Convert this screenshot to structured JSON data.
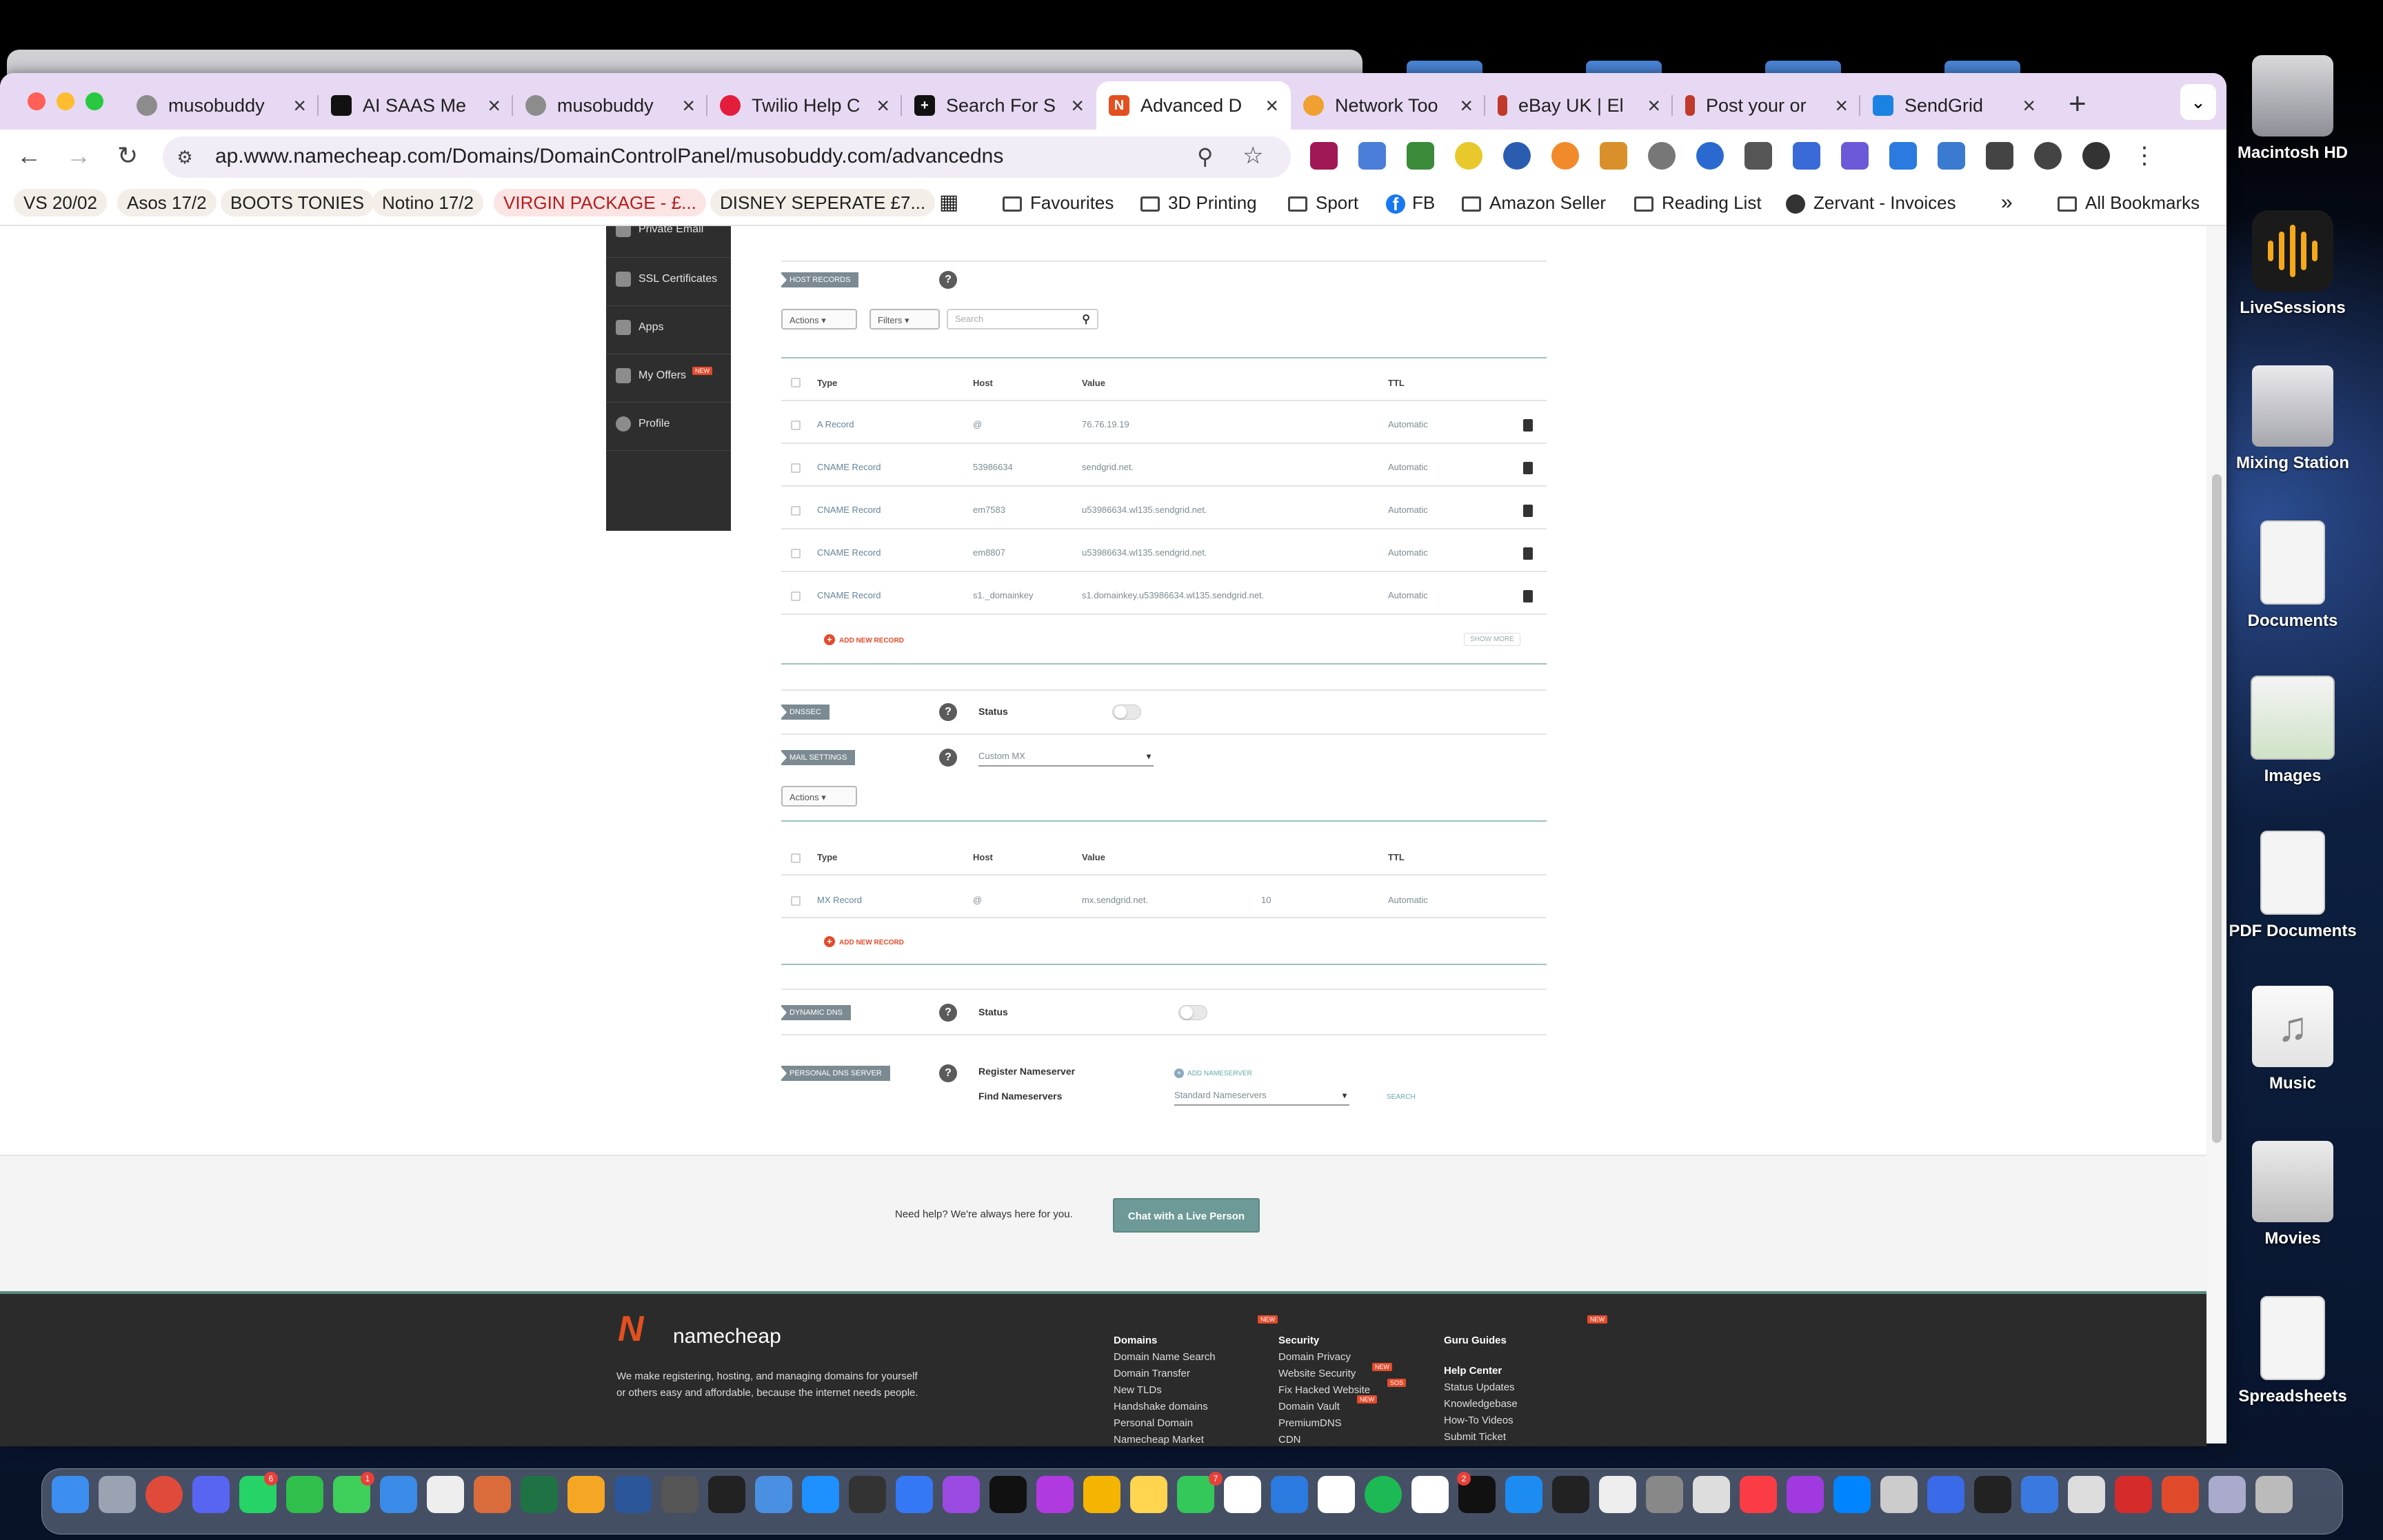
{
  "desktop": {
    "icons": [
      {
        "label": "Macintosh HD",
        "icon": "hard-drive-icon"
      },
      {
        "label": "LiveSessions",
        "icon": "waveform-app-icon"
      },
      {
        "label": "Mixing Station",
        "icon": "external-drive-icon"
      },
      {
        "label": "Documents",
        "icon": "document-stack-icon"
      },
      {
        "label": "Images",
        "icon": "image-stack-icon"
      },
      {
        "label": "PDF Documents",
        "icon": "pdf-stack-icon"
      },
      {
        "label": "Music",
        "icon": "music-file-icon"
      },
      {
        "label": "Movies",
        "icon": "movie-stack-icon"
      },
      {
        "label": "Spreadsheets",
        "icon": "spreadsheet-stack-icon"
      }
    ]
  },
  "browser": {
    "tabs": [
      {
        "title": "musobuddy",
        "icon": "globe-icon",
        "color": "#777777"
      },
      {
        "title": "AI SAAS Me",
        "icon": "aw-logo-icon",
        "color": "#111111"
      },
      {
        "title": "musobuddy",
        "icon": "globe-icon",
        "color": "#777777"
      },
      {
        "title": "Twilio Help C",
        "icon": "twilio-icon",
        "color": "#e31e3c"
      },
      {
        "title": "Search For S",
        "icon": "plus-icon",
        "color": "#111111"
      },
      {
        "title": "Advanced D",
        "icon": "namecheap-icon",
        "color": "#e35020",
        "active": true
      },
      {
        "title": "Network Too",
        "icon": "network-tool-icon",
        "color": "#f0a030"
      },
      {
        "title": "eBay UK | El",
        "icon": "ebay-icon",
        "color": "#c0392b"
      },
      {
        "title": "Post your or",
        "icon": "post-icon",
        "color": "#c0392b"
      },
      {
        "title": "SendGrid",
        "icon": "sendgrid-icon",
        "color": "#1a82e2"
      }
    ],
    "new_tab": "+",
    "tab_close": "×",
    "url": "ap.www.namecheap.com/Domains/DomainControlPanel/musobuddy.com/advancedns",
    "bookmarks": [
      {
        "label": "VS 20/02",
        "style": "chip"
      },
      {
        "label": "Asos 17/2",
        "style": "chip"
      },
      {
        "label": "BOOTS TONIES",
        "style": "chip"
      },
      {
        "label": "Notino 17/2",
        "style": "chip"
      },
      {
        "label": "VIRGIN PACKAGE - £...",
        "style": "red"
      },
      {
        "label": "DISNEY SEPERATE £7...",
        "style": "chip"
      },
      {
        "label": "Favourites",
        "style": "folder"
      },
      {
        "label": "3D Printing",
        "style": "folder"
      },
      {
        "label": "Sport",
        "style": "folder"
      },
      {
        "label": "FB",
        "style": "facebook"
      },
      {
        "label": "Amazon Seller",
        "style": "folder"
      },
      {
        "label": "Reading List",
        "style": "folder"
      },
      {
        "label": "Zervant - Invoices",
        "style": "site"
      },
      {
        "label": "All Bookmarks",
        "style": "folder"
      }
    ],
    "overflow": "»"
  },
  "sidenav": [
    {
      "label": "Private Email",
      "icon": "envelope-icon"
    },
    {
      "label": "SSL Certificates",
      "icon": "lock-icon"
    },
    {
      "label": "Apps",
      "icon": "apps-icon"
    },
    {
      "label": "My Offers",
      "icon": "tag-icon",
      "badge": "NEW"
    },
    {
      "label": "Profile",
      "icon": "gear-icon"
    }
  ],
  "host_records": {
    "tag": "HOST RECORDS",
    "actions": "Actions",
    "filters": "Filters",
    "search_placeholder": "Search",
    "columns": [
      "Type",
      "Host",
      "Value",
      "TTL"
    ],
    "rows": [
      {
        "type": "A Record",
        "host": "@",
        "value": "76.76.19.19",
        "ttl": "Automatic"
      },
      {
        "type": "CNAME Record",
        "host": "53986634",
        "value": "sendgrid.net.",
        "ttl": "Automatic"
      },
      {
        "type": "CNAME Record",
        "host": "em7583",
        "value": "u53986634.wl135.sendgrid.net.",
        "ttl": "Automatic"
      },
      {
        "type": "CNAME Record",
        "host": "em8807",
        "value": "u53986634.wl135.sendgrid.net.",
        "ttl": "Automatic"
      },
      {
        "type": "CNAME Record",
        "host": "s1._domainkey",
        "value": "s1.domainkey.u53986634.wl135.sendgrid.net.",
        "ttl": "Automatic"
      }
    ],
    "add_new": "ADD NEW RECORD",
    "show_more": "SHOW MORE"
  },
  "dnssec": {
    "tag": "DNSSEC",
    "status_label": "Status",
    "enabled": false
  },
  "mail_settings": {
    "tag": "MAIL SETTINGS",
    "selected": "Custom MX",
    "actions": "Actions",
    "columns": [
      "Type",
      "Host",
      "Value",
      "TTL"
    ],
    "rows": [
      {
        "type": "MX Record",
        "host": "@",
        "value": "mx.sendgrid.net.",
        "priority": "10",
        "ttl": "Automatic"
      }
    ],
    "add_new": "ADD NEW RECORD"
  },
  "dynamic_dns": {
    "tag": "DYNAMIC DNS",
    "status_label": "Status",
    "enabled": false
  },
  "personal_dns": {
    "tag": "PERSONAL DNS SERVER",
    "register_label": "Register Nameserver",
    "add_nameserver": "ADD NAMESERVER",
    "find_label": "Find Nameservers",
    "find_selected": "Standard Nameservers",
    "search": "SEARCH"
  },
  "help_band": {
    "text": "Need help? We're always here for you.",
    "chat_button": "Chat with a Live Person"
  },
  "footer": {
    "logo_text": "namecheap",
    "description": "We make registering, hosting, and managing domains for yourself or others easy and affordable, because the internet needs people.",
    "new_badge": "NEW",
    "sos_badge": "SOS",
    "domains": {
      "heading": "Domains",
      "links": [
        "Domain Name Search",
        "Domain Transfer",
        "New TLDs",
        "Handshake domains",
        "Personal Domain",
        "Namecheap Market"
      ]
    },
    "security": {
      "heading": "Security",
      "links": [
        "Domain Privacy",
        "Website Security",
        "Fix Hacked Website",
        "Domain Vault",
        "PremiumDNS",
        "CDN"
      ]
    },
    "guru": {
      "heading": "Guru Guides",
      "help_center": "Help Center",
      "links": [
        "Status Updates",
        "Knowledgebase",
        "How-To Videos",
        "Submit Ticket"
      ]
    }
  },
  "dock": {
    "badges": [
      "6",
      "1",
      "7",
      "2"
    ]
  }
}
